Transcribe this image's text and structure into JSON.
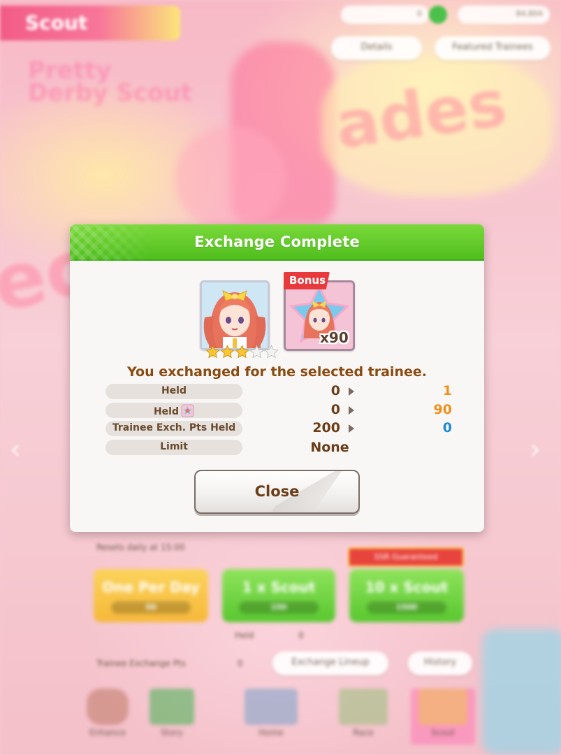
{
  "background": {
    "header_title": "Scout",
    "top_resources": [
      {
        "value": "0"
      },
      {
        "value": "84,804"
      }
    ],
    "top_buttons": {
      "details": "Details",
      "featured_trainees": "Featured Trainees"
    },
    "reset_note": "Resets daily at 15:00",
    "guarantee_badge": "SSR Guaranteed",
    "scout_buttons": {
      "one_per_day": "One Per Day",
      "one_per_day_cost": "50",
      "one_scout": "1 x Scout",
      "one_scout_cost": "150",
      "ten_scout": "10 x Scout",
      "ten_scout_cost": "1500"
    },
    "held_label": "Held",
    "held_value": "0",
    "exchange_pts_label": "Trainee Exchange Pts",
    "exchange_pts_value": "0",
    "exchange_lineup": "Exchange Lineup",
    "history": "History",
    "nav": [
      "Enhance",
      "Story",
      "Home",
      "Race",
      "Scout"
    ]
  },
  "modal": {
    "title": "Exchange Complete",
    "trainee": {
      "icon": "trainee-portrait",
      "rarity_stars": 3,
      "max_stars": 5
    },
    "bonus": {
      "tag": "Bonus",
      "quantity": "x90",
      "icon": "trainee-piece"
    },
    "message": "You exchanged for the selected trainee.",
    "rows": [
      {
        "label": "Held",
        "before": "0",
        "after": "1",
        "after_color": "#f0901a"
      },
      {
        "label": "Held",
        "icon": "trainee-piece-icon",
        "before": "0",
        "after": "90",
        "after_color": "#f0901a"
      },
      {
        "label": "Trainee Exch. Pts Held",
        "before": "200",
        "after": "0",
        "after_color": "#1f8ad4"
      },
      {
        "label": "Limit",
        "value": "None"
      }
    ],
    "close_label": "Close"
  }
}
